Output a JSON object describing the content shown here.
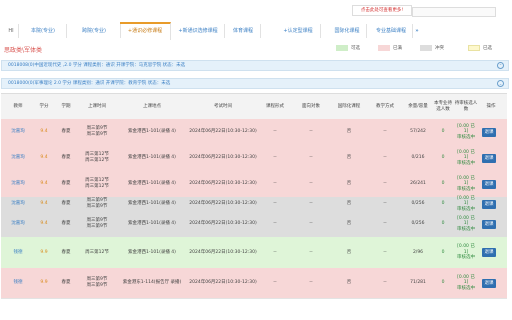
{
  "tabs": [
    {
      "label": "HI"
    },
    {
      "label": "本院(专业)"
    },
    {
      "label": "跨院(专业)"
    },
    {
      "label": "+通识必修课程"
    },
    {
      "label": "+新通识选修课程"
    },
    {
      "label": "体育课程"
    },
    {
      "label": "+认定型课程"
    },
    {
      "label": "国际化课程"
    },
    {
      "label": "专业基础课程"
    },
    {
      "label": "»"
    }
  ],
  "hint": "点击此处可查看更多!",
  "page_title": "思政类\\军体类",
  "legend": [
    {
      "label": "可选",
      "color": "#cfeec8"
    },
    {
      "label": "已满",
      "color": "#f7d7d7"
    },
    {
      "label": "冲突",
      "color": "#dddddd"
    },
    {
      "label": "已选",
      "color": "#fdf8cc"
    }
  ],
  "section1": {
    "text": "0018008(0)中国近现代史    ,2.0 学分    课程类别：通识    开课学院：马克思学院    状态：未选",
    "icon": "chevron-icon"
  },
  "section2": {
    "text": "0018000(0)军事理论    2.0 学分    课程类别：通识    开课学院：教育学院    状态：未选",
    "icon": "chevron-icon"
  },
  "headers": [
    "教师",
    "学分",
    "学期",
    "上课时间",
    "上课地点",
    "考试时间",
    "课程形式",
    "面向对象",
    "国际化课程",
    "教学方式",
    "余量/容量",
    "本专业待选人数",
    "待审核选人数",
    "操作"
  ],
  "rows": [
    {
      "teacher": "沈嘉珣",
      "credit": "9.4",
      "term": "春夏",
      "time": "周三第9节\n周三第9节",
      "place": "紫金港西1-101(录播 4)",
      "exam": "2024年06月22日(10:30-12:30)",
      "form": "--",
      "target": "--",
      "intl": "否",
      "mode": "--",
      "cap": "57/242",
      "w1": "0",
      "w2": "[0.00 已\n1]\n审核选中",
      "btn": "退课",
      "bg": "#f7d7d7"
    },
    {
      "teacher": "沈嘉珣",
      "credit": "9.4",
      "term": "春夏",
      "time": "周三第12节\n周三第12节",
      "place": "紫金港西1-101(录播 4)",
      "exam": "2024年06月22日(10:30-12:30)",
      "form": "--",
      "target": "--",
      "intl": "否",
      "mode": "--",
      "cap": "0/216",
      "w1": "0",
      "w2": "[0.00 已\n1]\n审核选中",
      "btn": "退课",
      "bg": "#f7d7d7"
    },
    {
      "teacher": "沈嘉珣",
      "credit": "9.4",
      "term": "春夏",
      "time": "周三第12节\n周三第12节",
      "place": "紫金港西1-101(录播 4)",
      "exam": "2024年06月22日(10:30-12:30)",
      "form": "--",
      "target": "--",
      "intl": "否",
      "mode": "--",
      "cap": "26/241",
      "w1": "0",
      "w2": "[0.00 已\n1]\n审核选中",
      "btn": "退课",
      "bg": "#f7d7d7"
    },
    {
      "teacher": "沈嘉珣",
      "credit": "9.4",
      "term": "春夏",
      "time": "周三第9节\n周三第9节",
      "place": "紫金港西1-101(录播 4)",
      "exam": "2024年06月22日(10:30-12:30)",
      "form": "--",
      "target": "--",
      "intl": "否",
      "mode": "--",
      "cap": "0/256",
      "w1": "0",
      "w2": "[0.00 已\n1]\n审核选中",
      "btn": "退课",
      "bg": "#dddddd"
    },
    {
      "teacher": "沈嘉珣",
      "credit": "9.4",
      "term": "春夏",
      "time": "周三第9节\n周三第9节",
      "place": "紫金港西1-101(录播 4)",
      "exam": "2024年06月22日(10:30-12:30)",
      "form": "--",
      "target": "--",
      "intl": "否",
      "mode": "--",
      "cap": "0/256",
      "w1": "0",
      "w2": "[0.00 已\n1]\n审核选中",
      "btn": "退课",
      "bg": "#dddddd"
    },
    {
      "teacher": "钱德",
      "credit": "9.9",
      "term": "春夏",
      "time": "周三第12节",
      "place": "紫金港西1-101(录播 4)",
      "exam": "2024年06月22日(10:30-12:30)",
      "form": "--",
      "target": "--",
      "intl": "否",
      "mode": "--",
      "cap": "2/96",
      "w1": "0",
      "w2": "[0.00 已\n1]\n审核选中",
      "btn": "退课",
      "bg": "#dff5d8"
    },
    {
      "teacher": "钱德",
      "credit": "9.9",
      "term": "春夏",
      "time": "周三第9节\n周三第9节",
      "place": "紫金港东1-114(报告厅 录播)",
      "exam": "2024年06月22日(10:30-12:30)",
      "form": "--",
      "target": "--",
      "intl": "否",
      "mode": "--",
      "cap": "71/281",
      "w1": "0",
      "w2": "[0.00 已\n1]\n审核选中",
      "btn": "退课",
      "bg": "#f7d7d7"
    }
  ]
}
